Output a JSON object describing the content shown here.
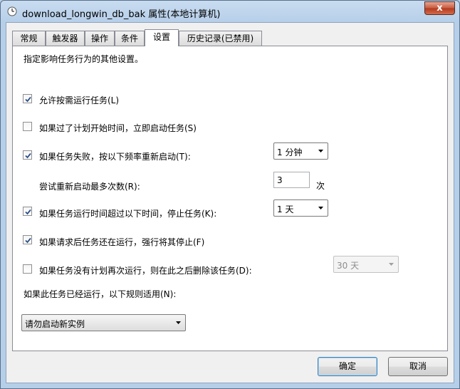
{
  "window": {
    "title": "download_longwin_db_bak 属性(本地计算机)",
    "close_label": "x"
  },
  "tabs": [
    {
      "label": "常规",
      "active": false
    },
    {
      "label": "触发器",
      "active": false
    },
    {
      "label": "操作",
      "active": false
    },
    {
      "label": "条件",
      "active": false
    },
    {
      "label": "设置",
      "active": true
    },
    {
      "label": "历史记录(已禁用)",
      "active": false
    }
  ],
  "settings": {
    "description": "指定影响任务行为的其他设置。",
    "allow_on_demand": {
      "label": "允许按需运行任务(L)",
      "checked": true
    },
    "start_if_missed": {
      "label": "如果过了计划开始时间，立即启动任务(S)",
      "checked": false
    },
    "restart_on_fail": {
      "label": "如果任务失败，按以下频率重新启动(T):",
      "checked": true,
      "interval": "1 分钟"
    },
    "restart_attempts": {
      "label": "尝试重新启动最多次数(R):",
      "value": "3",
      "unit": "次"
    },
    "stop_if_longer": {
      "label": "如果任务运行时间超过以下时间，停止任务(K):",
      "checked": true,
      "duration": "1 天"
    },
    "force_stop": {
      "label": "如果请求后任务还在运行，强行将其停止(F)",
      "checked": true
    },
    "delete_if_not_scheduled": {
      "label": "如果任务没有计划再次运行，则在此之后删除该任务(D):",
      "checked": false,
      "after": "30 天"
    },
    "rule_label": "如果此任务已经运行，以下规则适用(N):",
    "rule_value": "请勿启动新实例"
  },
  "buttons": {
    "ok": "确定",
    "cancel": "取消"
  }
}
